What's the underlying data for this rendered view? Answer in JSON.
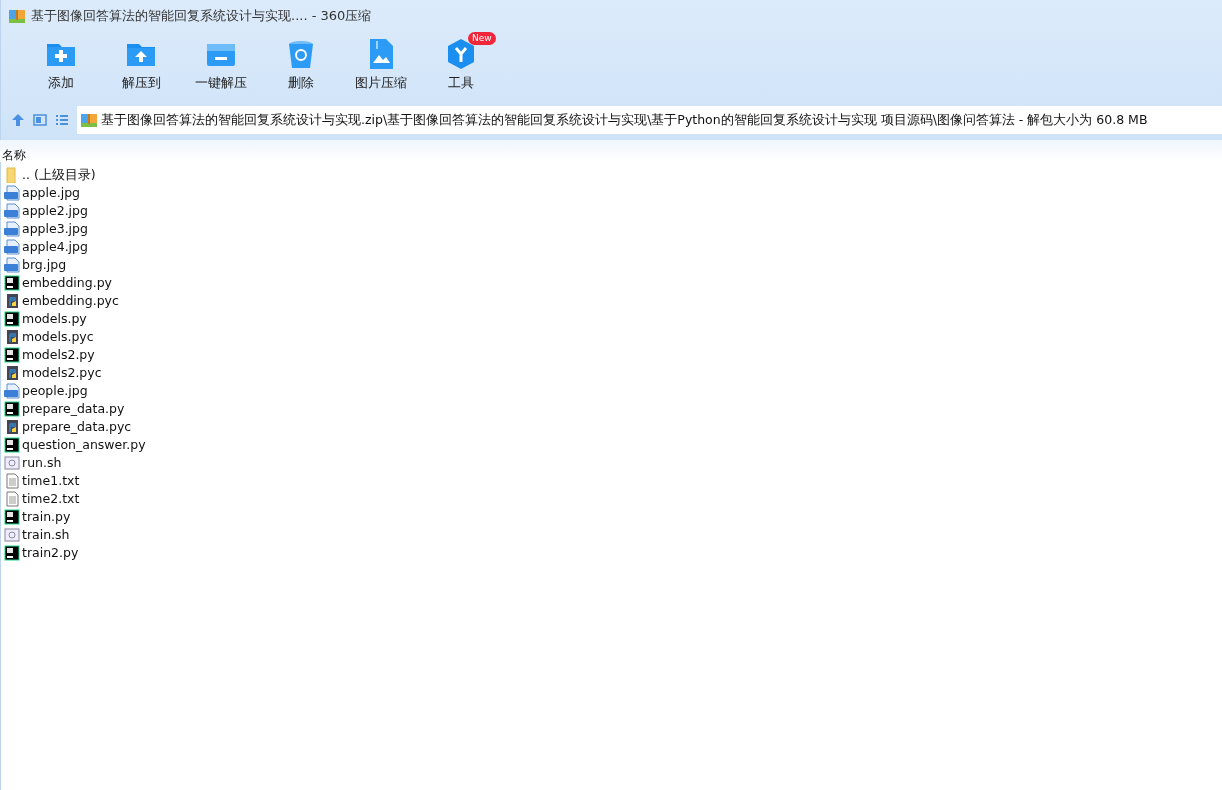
{
  "window": {
    "title": "基于图像回答算法的智能回复系统设计与实现.... - 360压缩"
  },
  "toolbar": [
    {
      "label": "添加",
      "kind": "add"
    },
    {
      "label": "解压到",
      "kind": "extract"
    },
    {
      "label": "一键解压",
      "kind": "oneclick"
    },
    {
      "label": "删除",
      "kind": "delete"
    },
    {
      "label": "图片压缩",
      "kind": "image"
    },
    {
      "label": "工具",
      "kind": "tools",
      "badge": "New"
    }
  ],
  "address": {
    "path": "基于图像回答算法的智能回复系统设计与实现.zip\\基于图像回答算法的智能回复系统设计与实现\\基于Python的智能回复系统设计与实现 项目源码\\图像问答算法 - 解包大小为 60.8 MB"
  },
  "table": {
    "columns": [
      "名称"
    ],
    "rows": [
      {
        "name": ".. (上级目录)",
        "kind": "folder"
      },
      {
        "name": "apple.jpg",
        "kind": "jpg"
      },
      {
        "name": "apple2.jpg",
        "kind": "jpg"
      },
      {
        "name": "apple3.jpg",
        "kind": "jpg"
      },
      {
        "name": "apple4.jpg",
        "kind": "jpg"
      },
      {
        "name": "brg.jpg",
        "kind": "jpg"
      },
      {
        "name": "embedding.py",
        "kind": "py"
      },
      {
        "name": "embedding.pyc",
        "kind": "pyc"
      },
      {
        "name": "models.py",
        "kind": "py"
      },
      {
        "name": "models.pyc",
        "kind": "pyc"
      },
      {
        "name": "models2.py",
        "kind": "py"
      },
      {
        "name": "models2.pyc",
        "kind": "pyc"
      },
      {
        "name": "people.jpg",
        "kind": "jpg"
      },
      {
        "name": "prepare_data.py",
        "kind": "py"
      },
      {
        "name": "prepare_data.pyc",
        "kind": "pyc"
      },
      {
        "name": "question_answer.py",
        "kind": "py"
      },
      {
        "name": "run.sh",
        "kind": "sh"
      },
      {
        "name": "time1.txt",
        "kind": "txt"
      },
      {
        "name": "time2.txt",
        "kind": "txt"
      },
      {
        "name": "train.py",
        "kind": "py"
      },
      {
        "name": "train.sh",
        "kind": "sh"
      },
      {
        "name": "train2.py",
        "kind": "py"
      }
    ]
  }
}
